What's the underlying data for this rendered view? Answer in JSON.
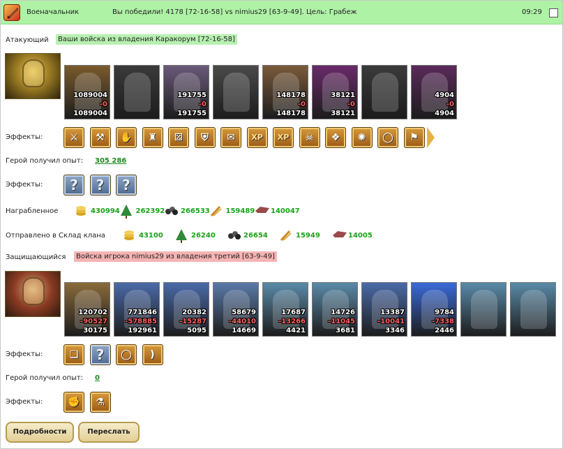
{
  "header": {
    "app_title": "Военачальник",
    "battle_summary": "Вы победили! 4178 [72-16-58] vs nimius29 [63-9-49]. Цель: Грабеж",
    "time": "09:29"
  },
  "attacker": {
    "role_label": "Атакующий",
    "origin_tag": "Ваши войска из владения Каракорум [72-16-58]",
    "units": [
      {
        "start": "1089004",
        "lost": "-0",
        "end": "1089004",
        "tint": "#7a5a2c"
      },
      {
        "start": "",
        "lost": "",
        "end": "",
        "tint": "#3a3a3a"
      },
      {
        "start": "191755",
        "lost": "-0",
        "end": "191755",
        "tint": "#6a5a7a"
      },
      {
        "start": "",
        "lost": "",
        "end": "",
        "tint": "#4a4a4a"
      },
      {
        "start": "148178",
        "lost": "-0",
        "end": "148178",
        "tint": "#7a5a3a"
      },
      {
        "start": "38121",
        "lost": "-0",
        "end": "38121",
        "tint": "#6a2a6a"
      },
      {
        "start": "",
        "lost": "",
        "end": "",
        "tint": "#3a3a3a"
      },
      {
        "start": "4904",
        "lost": "-0",
        "end": "4904",
        "tint": "#5a2a5a"
      }
    ],
    "effects_label": "Эффекты:",
    "effects": [
      {
        "icon": "sword-icon",
        "glyph": "⚔"
      },
      {
        "icon": "axe-icon",
        "glyph": "⚒"
      },
      {
        "icon": "hand-icon",
        "glyph": "✋"
      },
      {
        "icon": "fortress-icon",
        "glyph": "♜"
      },
      {
        "icon": "dice-icon",
        "glyph": "⚄"
      },
      {
        "icon": "shield-icon",
        "glyph": "⛨"
      },
      {
        "icon": "scroll-icon",
        "glyph": "✉"
      },
      {
        "icon": "xp-icon",
        "glyph": "XP"
      },
      {
        "icon": "xp-boost-icon",
        "glyph": "XP"
      },
      {
        "icon": "demon-icon",
        "glyph": "☠"
      },
      {
        "icon": "amulet-icon",
        "glyph": "❖"
      },
      {
        "icon": "magic-icon",
        "glyph": "✺"
      },
      {
        "icon": "ring-icon",
        "glyph": "◯"
      },
      {
        "icon": "banner-icon",
        "glyph": "⚑"
      }
    ],
    "xp_label": "Герой получил опыт:",
    "xp_value": "305 286",
    "effects2_label": "Эффекты:",
    "effects2": [
      {
        "icon": "unknown-effect-icon",
        "glyph": "?"
      },
      {
        "icon": "unknown-effect-icon",
        "glyph": "?"
      },
      {
        "icon": "unknown-effect-icon",
        "glyph": "?"
      }
    ]
  },
  "loot": {
    "label": "Награбленное",
    "items": [
      {
        "icon": "gold-icon",
        "value": "430994",
        "color": "#d6a420"
      },
      {
        "icon": "wood-icon",
        "value": "262392",
        "color": "#2f8a3a"
      },
      {
        "icon": "ore-icon",
        "value": "266533",
        "color": "#555555"
      },
      {
        "icon": "grain-icon",
        "value": "159489",
        "color": "#c98a2a"
      },
      {
        "icon": "stone-icon",
        "value": "140047",
        "color": "#9a4a4a"
      }
    ]
  },
  "clan_store": {
    "label": "Отправлено в Склад клана",
    "items": [
      {
        "icon": "gold-icon",
        "value": "43100",
        "color": "#d6a420"
      },
      {
        "icon": "wood-icon",
        "value": "26240",
        "color": "#2f8a3a"
      },
      {
        "icon": "ore-icon",
        "value": "26654",
        "color": "#555555"
      },
      {
        "icon": "grain-icon",
        "value": "15949",
        "color": "#c98a2a"
      },
      {
        "icon": "stone-icon",
        "value": "14005",
        "color": "#9a4a4a"
      }
    ]
  },
  "defender": {
    "role_label": "Защищающийся",
    "origin_tag": "Войска игрока nimius29 из владения третий [63-9-49]",
    "units": [
      {
        "start": "120702",
        "lost": "-90527",
        "end": "30175",
        "tint": "#8a6a3a"
      },
      {
        "start": "771846",
        "lost": "-578885",
        "end": "192961",
        "tint": "#4a6aa8"
      },
      {
        "start": "20382",
        "lost": "-15287",
        "end": "5095",
        "tint": "#4a6aa8"
      },
      {
        "start": "58679",
        "lost": "-44010",
        "end": "14669",
        "tint": "#5a7aa8"
      },
      {
        "start": "17687",
        "lost": "-13266",
        "end": "4421",
        "tint": "#5a8aa8"
      },
      {
        "start": "14726",
        "lost": "-11045",
        "end": "3681",
        "tint": "#5a8aa8"
      },
      {
        "start": "13387",
        "lost": "-10041",
        "end": "3346",
        "tint": "#4a6aa8"
      },
      {
        "start": "9784",
        "lost": "-7338",
        "end": "2446",
        "tint": "#3a6ad8"
      },
      {
        "start": "",
        "lost": "",
        "end": "",
        "tint": "#5a8aa8"
      },
      {
        "start": "",
        "lost": "",
        "end": "",
        "tint": "#5a8aa8"
      }
    ],
    "effects_label": "Эффекты:",
    "effects": [
      {
        "icon": "book-icon",
        "glyph": "❏"
      },
      {
        "icon": "unknown-effect-icon",
        "glyph": "?"
      },
      {
        "icon": "ring-icon",
        "glyph": "◯"
      },
      {
        "icon": "bow-icon",
        "glyph": ")"
      }
    ],
    "xp_label": "Герой получил опыт:",
    "xp_value": "0",
    "effects2_label": "Эффекты:",
    "effects2": [
      {
        "icon": "fist-icon",
        "glyph": "✊"
      },
      {
        "icon": "potion-icon",
        "glyph": "⚗"
      }
    ]
  },
  "buttons": {
    "details": "Подробности",
    "forward": "Переслать"
  }
}
